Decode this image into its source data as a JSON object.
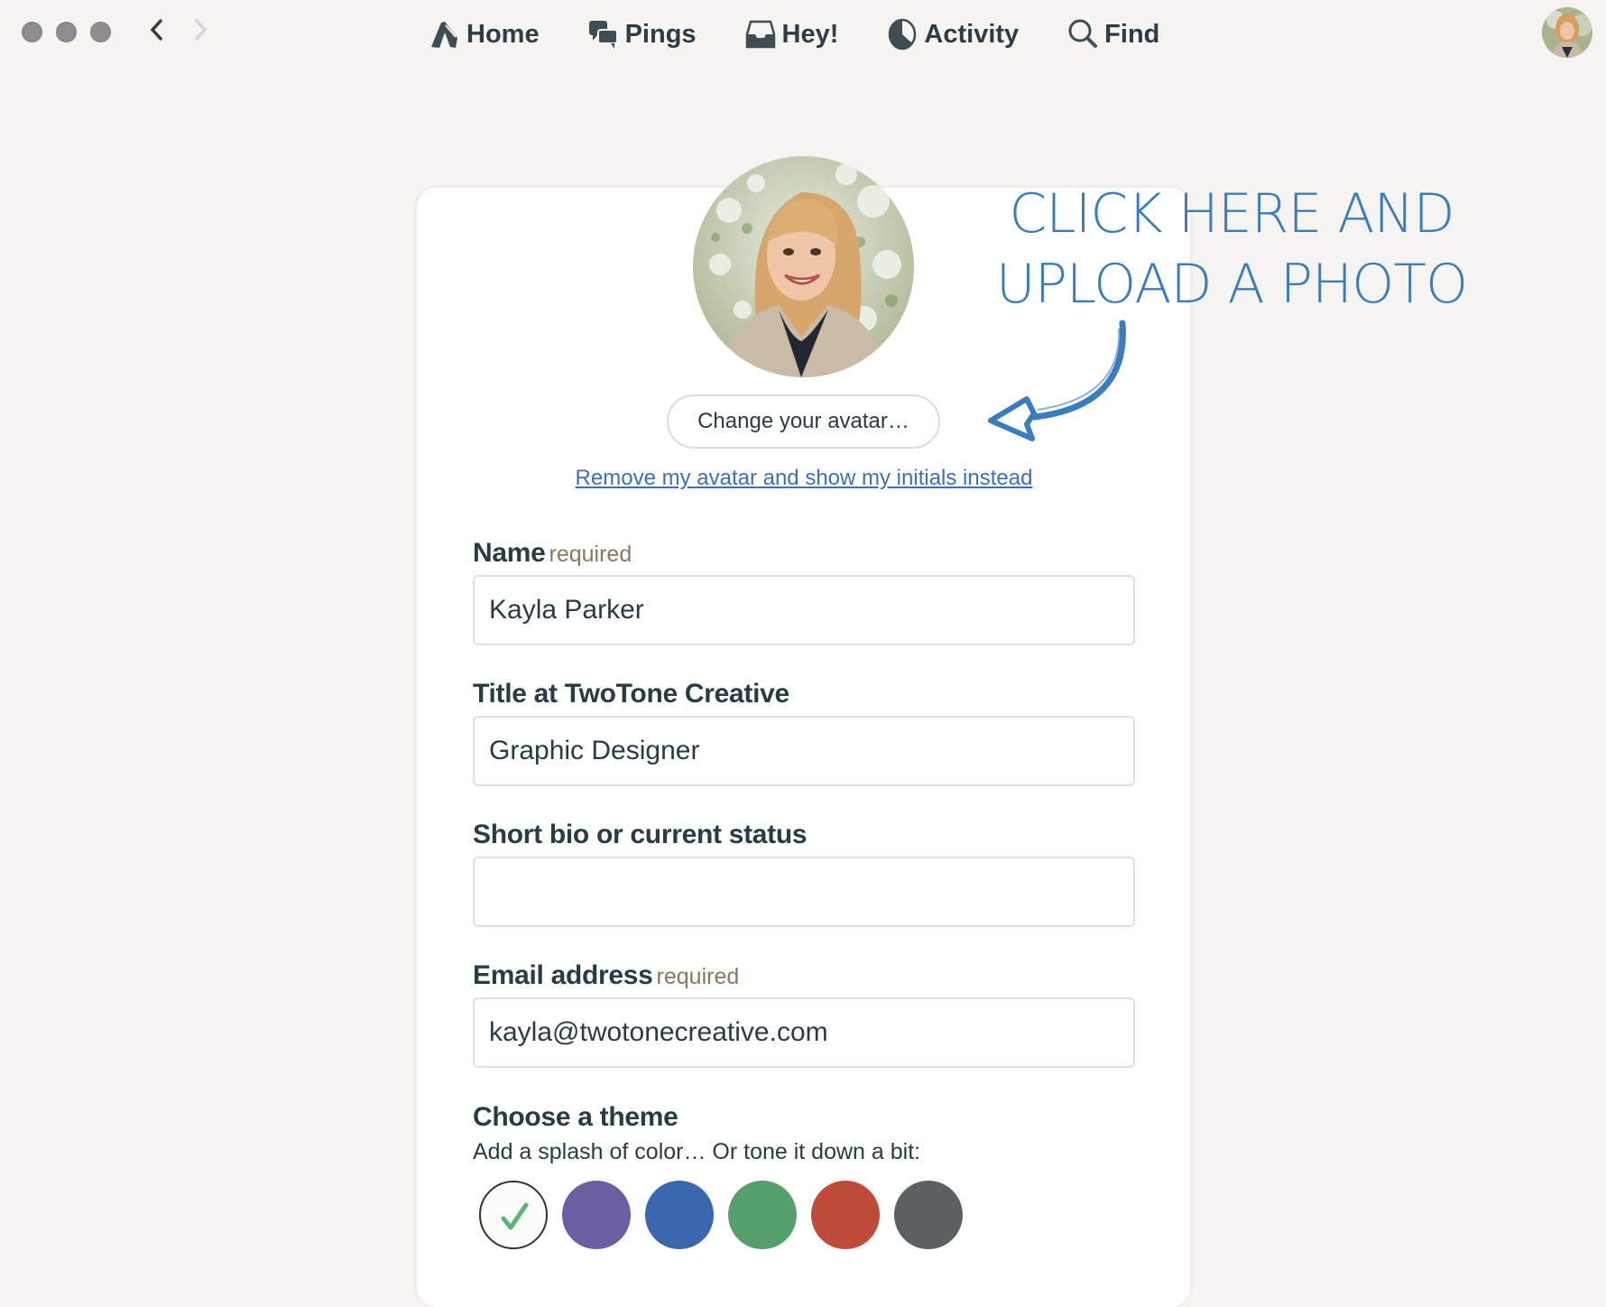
{
  "window": {
    "traffic_lights": [
      "close",
      "minimize",
      "zoom"
    ],
    "back_icon": "chevron-left-icon",
    "forward_icon": "chevron-right-icon"
  },
  "nav": {
    "items": [
      {
        "label": "Home",
        "icon": "home-tent-icon"
      },
      {
        "label": "Pings",
        "icon": "chat-bubbles-icon"
      },
      {
        "label": "Hey!",
        "icon": "inbox-tray-icon"
      },
      {
        "label": "Activity",
        "icon": "pie-clock-icon"
      },
      {
        "label": "Find",
        "icon": "search-icon"
      }
    ],
    "user_avatar": "user-avatar-photo"
  },
  "profile": {
    "avatar": "profile-photo",
    "change_avatar_label": "Change your avatar…",
    "remove_avatar_label": "Remove my avatar and show my initials instead",
    "fields": {
      "name": {
        "label": "Name",
        "required_label": "required",
        "value": "Kayla Parker"
      },
      "title": {
        "label": "Title at TwoTone Creative",
        "value": "Graphic Designer"
      },
      "bio": {
        "label": "Short bio or current status",
        "value": ""
      },
      "email": {
        "label": "Email address",
        "required_label": "required",
        "value": "kayla@twotonecreative.com"
      }
    },
    "theme": {
      "heading": "Choose a theme",
      "subheading": "Add a splash of color… Or tone it down a bit:",
      "selected_index": 0,
      "swatches": [
        {
          "name": "default",
          "color": "#fcfcfa"
        },
        {
          "name": "purple",
          "color": "#6c5ea3"
        },
        {
          "name": "blue",
          "color": "#3b68ac"
        },
        {
          "name": "green",
          "color": "#55a06a"
        },
        {
          "name": "red",
          "color": "#bf4c3a"
        },
        {
          "name": "gray",
          "color": "#5b6163"
        }
      ],
      "check_color": "#5bb57a"
    }
  },
  "annotation": {
    "line1": "CLICK HERE AND",
    "line2": "UPLOAD A PHOTO",
    "color": "#3a7dbf"
  }
}
